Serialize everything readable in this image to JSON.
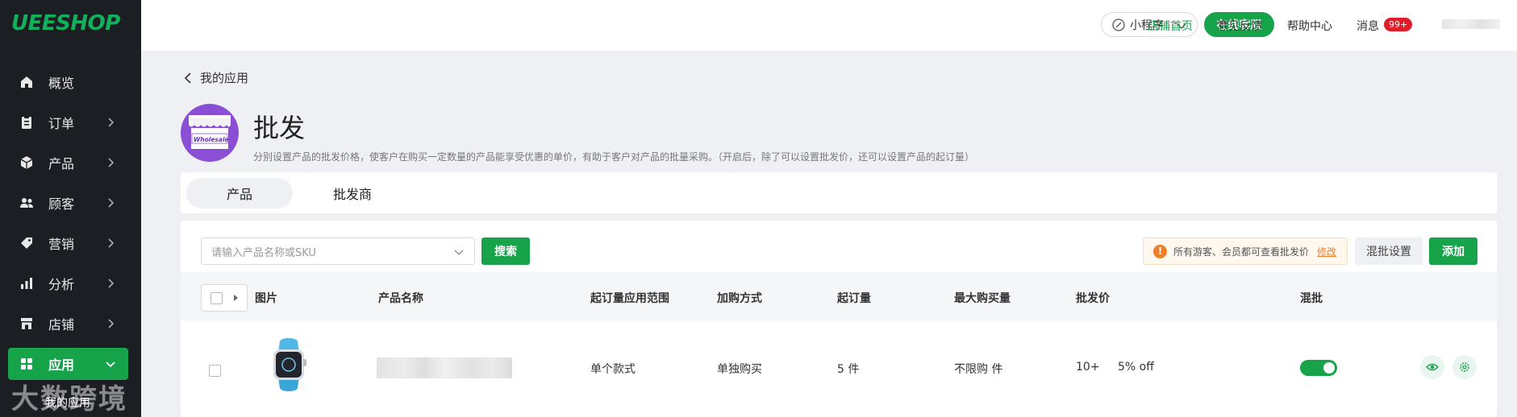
{
  "brand": {
    "logo_text": "UEESHOP"
  },
  "sidebar": {
    "items": [
      {
        "label": "概览",
        "icon": "home-icon"
      },
      {
        "label": "订单",
        "icon": "clipboard-icon"
      },
      {
        "label": "产品",
        "icon": "box-icon"
      },
      {
        "label": "顾客",
        "icon": "users-icon"
      },
      {
        "label": "营销",
        "icon": "tag-icon"
      },
      {
        "label": "分析",
        "icon": "bar-chart-icon"
      },
      {
        "label": "店铺",
        "icon": "store-icon"
      },
      {
        "label": "应用",
        "icon": "apps-icon",
        "active": true
      }
    ],
    "sub_item": "我的应用",
    "watermark": "大数跨境"
  },
  "header": {
    "mini_program": "小程序",
    "customer_service": "在线客服",
    "store_home": "店铺首页",
    "feedback": "意见反馈",
    "help_center": "帮助中心",
    "messages": "消息",
    "messages_badge": "99+"
  },
  "page": {
    "back_label": "我的应用",
    "app_logo_text": "Wholesale",
    "title": "批发",
    "description": "分别设置产品的批发价格，使客户在购买一定数量的产品能享受优惠的单价，有助于客户对产品的批量采购。（开启后，除了可以设置批发价，还可以设置产品的起订量）"
  },
  "tabs": [
    {
      "label": "产品",
      "active": true
    },
    {
      "label": "批发商",
      "active": false
    }
  ],
  "toolbar": {
    "search_placeholder": "请输入产品名称或SKU",
    "search_button": "搜索",
    "notice_text": "所有游客、会员都可查看批发价",
    "notice_link": "修改",
    "mixed_settings": "混批设置",
    "add_button": "添加"
  },
  "table": {
    "columns": [
      "图片",
      "产品名称",
      "起订量应用范围",
      "加购方式",
      "起订量",
      "最大购买量",
      "批发价",
      "混批"
    ],
    "rows": [
      {
        "scope": "单个款式",
        "purchase_mode": "单独购买",
        "min_order": "5 件",
        "max_purchase": "不限购 件",
        "wholesale_qty": "10+",
        "wholesale_discount": "5% off",
        "mixed": true
      }
    ]
  },
  "colors": {
    "accent": "#16a34a",
    "sidebar_bg": "#1b1e23",
    "warning": "#f07f2c",
    "badge": "#e11d2a"
  }
}
